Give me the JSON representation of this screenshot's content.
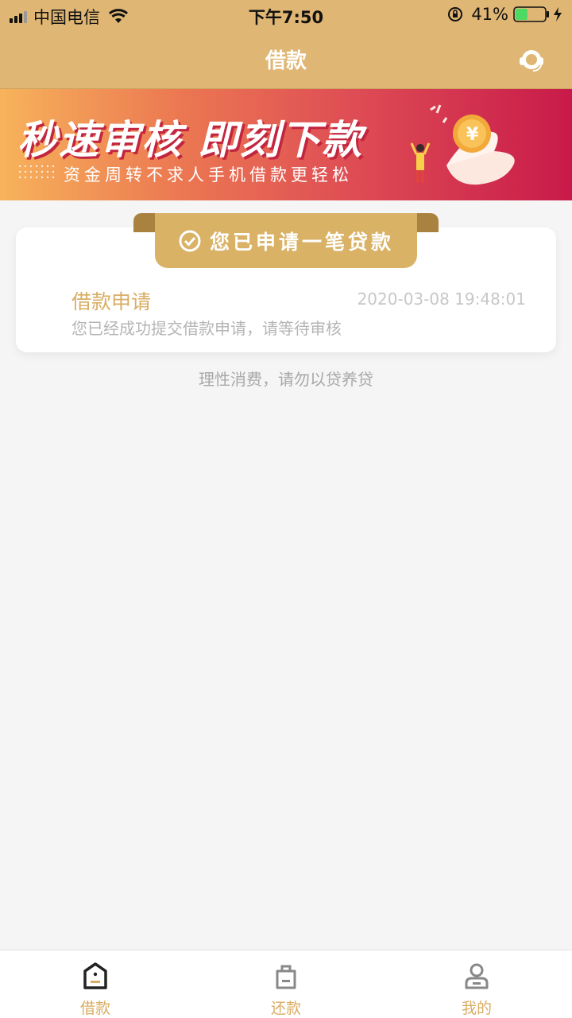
{
  "status_bar": {
    "carrier": "中国电信",
    "time": "下午7:50",
    "battery_percent": "41%",
    "battery_level": 0.41
  },
  "nav": {
    "title": "借款",
    "support_icon": "headset-icon"
  },
  "banner": {
    "title": "秒速审核 即刻下款",
    "subtitle": "资金周转不求人手机借款更轻松"
  },
  "status_card": {
    "ribbon_text": "您已申请一笔贷款",
    "item": {
      "title": "借款申请",
      "timestamp": "2020-03-08 19:48:01",
      "description": "您已经成功提交借款申请，请等待审核"
    }
  },
  "footer_note": "理性消费，请勿以贷养贷",
  "tabbar": {
    "tabs": [
      {
        "label": "借款",
        "icon": "loan-icon",
        "active": true
      },
      {
        "label": "还款",
        "icon": "repay-icon",
        "active": false
      },
      {
        "label": "我的",
        "icon": "user-icon",
        "active": false
      }
    ]
  },
  "colors": {
    "brand": "#dfb673",
    "accent": "#d9ad63",
    "battery_fill": "#4cd964"
  }
}
